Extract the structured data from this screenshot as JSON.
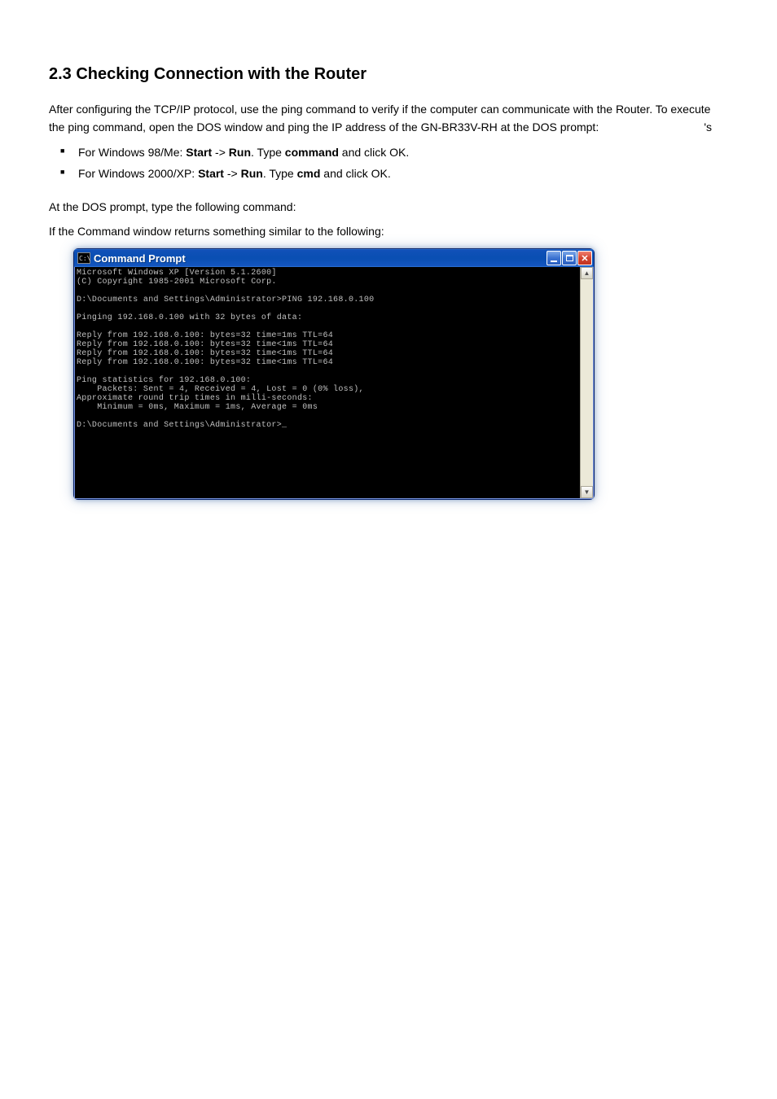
{
  "doc": {
    "heading1": "2.3 Checking Connection with the Router",
    "para1": "After configuring the TCP/IP protocol, use the ping command to verify if the computer can communicate with the Router. To execute the ping command, open the DOS window and ping the IP address of the GN-BR33V-RH at the DOS prompt:",
    "bulletPrefix": "For Windows 98/Me: ",
    "bulletRest": "Start -> Run. Type command and click OK.",
    "bulletPrefix2": "For Windows 2000/XP: ",
    "bulletRest2": "Start -> Run. Type cmd and click OK.",
    "para2": "At the DOS prompt, type the following command:",
    "para3": "If the Command window returns something similar to the following:",
    "apos": "'s"
  },
  "cmd": {
    "title": "Command Prompt",
    "iconText": "C:\\",
    "lines": [
      "Microsoft Windows XP [Version 5.1.2600]",
      "(C) Copyright 1985-2001 Microsoft Corp.",
      "",
      "D:\\Documents and Settings\\Administrator>PING 192.168.0.100",
      "",
      "Pinging 192.168.0.100 with 32 bytes of data:",
      "",
      "Reply from 192.168.0.100: bytes=32 time=1ms TTL=64",
      "Reply from 192.168.0.100: bytes=32 time<1ms TTL=64",
      "Reply from 192.168.0.100: bytes=32 time<1ms TTL=64",
      "Reply from 192.168.0.100: bytes=32 time<1ms TTL=64",
      "",
      "Ping statistics for 192.168.0.100:",
      "    Packets: Sent = 4, Received = 4, Lost = 0 (0% loss),",
      "Approximate round trip times in milli-seconds:",
      "    Minimum = 0ms, Maximum = 1ms, Average = 0ms",
      "",
      "D:\\Documents and Settings\\Administrator>_"
    ]
  }
}
